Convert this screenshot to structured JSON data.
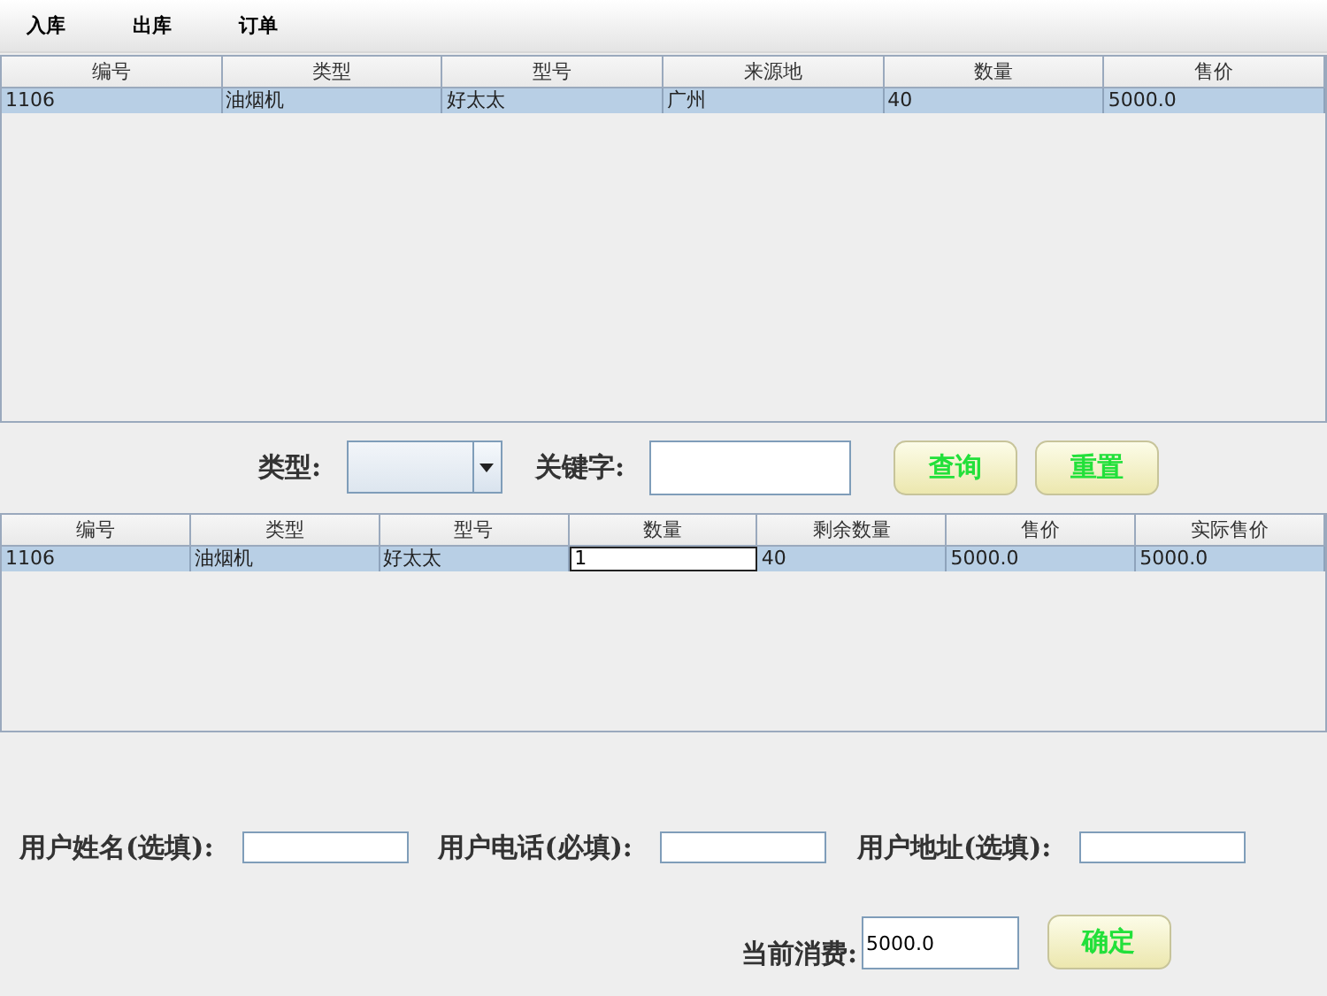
{
  "menu": [
    {
      "label": "入库"
    },
    {
      "label": "出库"
    },
    {
      "label": "订单"
    }
  ],
  "stock_table": {
    "columns": [
      "编号",
      "类型",
      "型号",
      "来源地",
      "数量",
      "售价"
    ],
    "rows": [
      {
        "selected": true,
        "cells": [
          {
            "kind": "text",
            "text": "1106"
          },
          {
            "kind": "text",
            "text": "油烟机"
          },
          {
            "kind": "text",
            "text": "好太太"
          },
          {
            "kind": "text",
            "text": "广州"
          },
          {
            "kind": "text",
            "text": "40"
          },
          {
            "kind": "text",
            "text": "5000.0"
          }
        ]
      }
    ]
  },
  "search": {
    "type_label": "类型:",
    "keyword_label": "关键字:",
    "buttons": [
      {
        "label": "查询"
      },
      {
        "label": "重置"
      }
    ]
  },
  "order_table": {
    "columns": [
      "编号",
      "类型",
      "型号",
      "数量",
      "剩余数量",
      "售价",
      "实际售价"
    ],
    "rows": [
      {
        "selected": true,
        "cells": [
          {
            "kind": "text",
            "text": "1106"
          },
          {
            "kind": "text",
            "text": "油烟机"
          },
          {
            "kind": "text",
            "text": "好太太"
          },
          {
            "kind": "editor",
            "text": "1"
          },
          {
            "kind": "text",
            "text": "40"
          },
          {
            "kind": "text",
            "text": "5000.0"
          },
          {
            "kind": "text",
            "text": "5000.0"
          }
        ]
      }
    ]
  },
  "customer": {
    "fields": [
      {
        "label": "用户姓名(选填):"
      },
      {
        "label": "用户电话(必填):"
      },
      {
        "label": "用户地址(选填):"
      }
    ]
  },
  "total": {
    "label": "当前消费:",
    "value": "5000.0"
  },
  "confirm_button": {
    "label": "确定"
  }
}
